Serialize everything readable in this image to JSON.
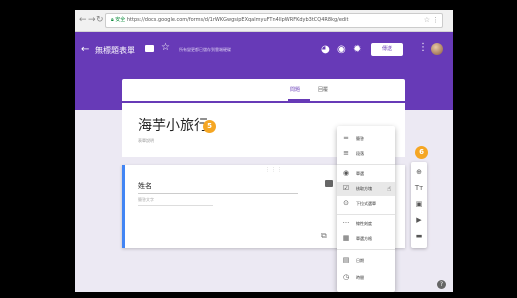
{
  "browser": {
    "back_icon": "back-arrow-icon",
    "forward_icon": "forward-arrow-icon",
    "reload_icon": "reload-icon",
    "lock_icon": "lock-icon",
    "secure_label": "安全",
    "url": "https://docs.google.com/forms/d/1rWKGwgsipEXqalmyuFTn4llpWRFKdyb3tCQ4R8kg/edit"
  },
  "appbar": {
    "title": "無標題表單",
    "save_status": "所有變更都已儲存到雲端硬碟",
    "send_label": "傳送"
  },
  "tabs": [
    {
      "label": "問題",
      "active": true
    },
    {
      "label": "回覆",
      "active": false
    }
  ],
  "form": {
    "title": "海芋小旅行",
    "description": "表單說明"
  },
  "question": {
    "label": "姓名",
    "hint": "簡答文字"
  },
  "badges": {
    "title_badge": "5",
    "toolbar_badge": "6"
  },
  "question_types": [
    {
      "icon": "short-answer-icon",
      "glyph": "═",
      "label": "簡答"
    },
    {
      "icon": "paragraph-icon",
      "glyph": "≡",
      "label": "段落"
    },
    {
      "icon": "radio-icon",
      "glyph": "◉",
      "label": "單選"
    },
    {
      "icon": "checkbox-icon",
      "glyph": "☑",
      "label": "核取方塊"
    },
    {
      "icon": "dropdown-icon",
      "glyph": "⊙",
      "label": "下拉式選單"
    },
    {
      "icon": "linear-scale-icon",
      "glyph": "···",
      "label": "線性刻度"
    },
    {
      "icon": "grid-icon",
      "glyph": "▦",
      "label": "單選方格"
    },
    {
      "icon": "date-icon",
      "glyph": "▤",
      "label": "日期"
    },
    {
      "icon": "time-icon",
      "glyph": "◷",
      "label": "時間"
    }
  ],
  "toolbar": [
    {
      "icon": "add-question-icon",
      "glyph": "⊕"
    },
    {
      "icon": "title-icon",
      "glyph": "Tт"
    },
    {
      "icon": "image-icon",
      "glyph": "▣"
    },
    {
      "icon": "video-icon",
      "glyph": "▶"
    },
    {
      "icon": "section-icon",
      "glyph": "▬"
    }
  ],
  "colors": {
    "theme": "#673ab7",
    "badge": "#f5a623",
    "question_accent": "#4285f4"
  }
}
